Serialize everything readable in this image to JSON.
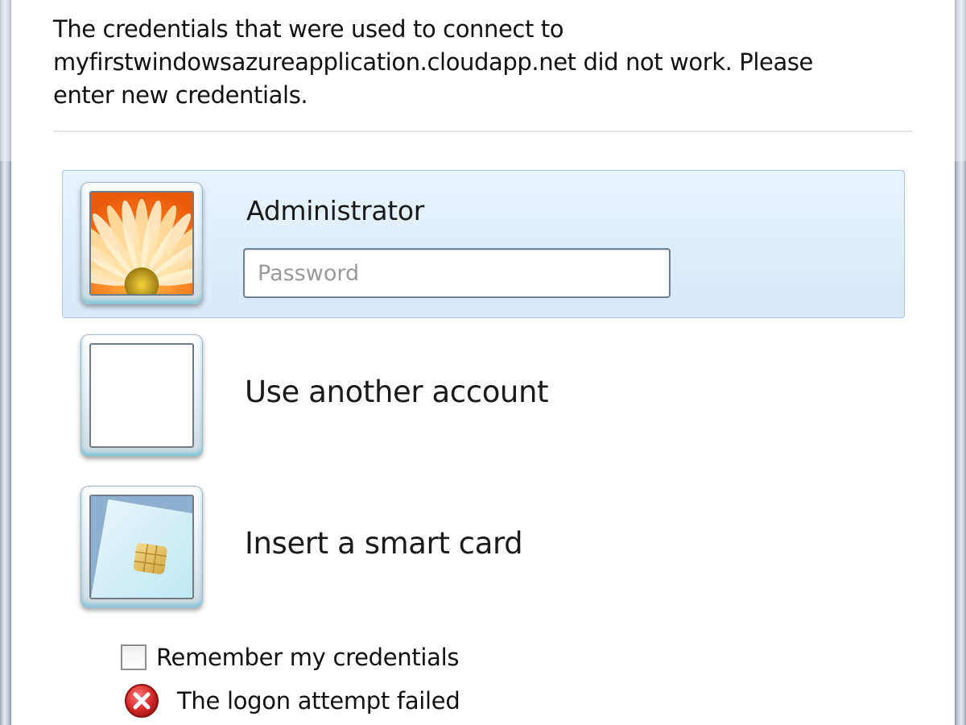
{
  "dialog": {
    "message": "The credentials that were used to connect to\nmyfirstwindowsazureapplication.cloudapp.net did not work. Please\nenter new credentials."
  },
  "accounts": [
    {
      "name": "Administrator",
      "password_placeholder": "Password",
      "password_value": "",
      "selected": true,
      "icon": "flower-avatar-icon"
    },
    {
      "label": "Use another account",
      "selected": false,
      "icon": "blank-avatar-icon"
    },
    {
      "label": "Insert a smart card",
      "selected": false,
      "icon": "smart-card-icon"
    }
  ],
  "remember": {
    "label": "Remember my credentials",
    "checked": false
  },
  "error": {
    "text": "The logon attempt failed",
    "icon": "error-icon"
  },
  "colors": {
    "selection_border": "#a9c7ea",
    "selection_bg": "#dceafb",
    "error_red": "#d62a2a"
  }
}
